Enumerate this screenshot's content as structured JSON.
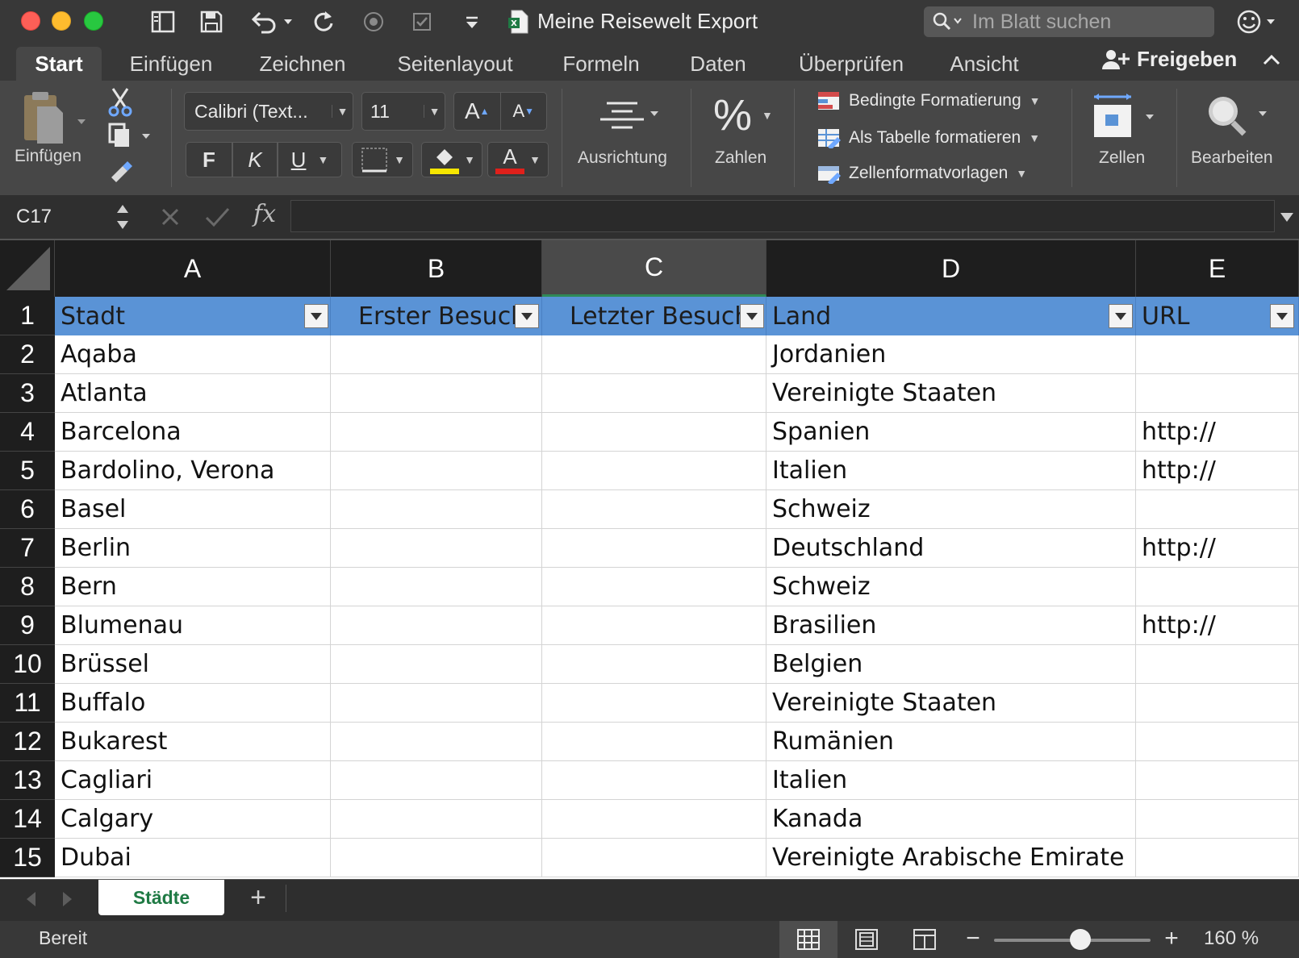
{
  "window": {
    "title": "Meine Reisewelt Export",
    "search_placeholder": "Im Blatt suchen"
  },
  "ribbon_tabs": [
    "Start",
    "Einfügen",
    "Zeichnen",
    "Seitenlayout",
    "Formeln",
    "Daten",
    "Überprüfen",
    "Ansicht"
  ],
  "share_label": "Freigeben",
  "ribbon": {
    "paste_label": "Einfügen",
    "font_name": "Calibri (Text...",
    "font_size": "11",
    "bold_label": "F",
    "italic_label": "K",
    "underline_label": "U",
    "grow_font": "A",
    "shrink_font": "A",
    "font_color_letter": "A",
    "alignment_label": "Ausrichtung",
    "number_label": "Zahlen",
    "percent_symbol": "%",
    "conditional_format": "Bedingte Formatierung",
    "format_as_table": "Als Tabelle formatieren",
    "cell_styles": "Zellenformatvorlagen",
    "cells_label": "Zellen",
    "editing_label": "Bearbeiten",
    "fill_color": "#f6e600",
    "font_color": "#e0201b"
  },
  "formula_bar": {
    "name_box": "C17",
    "fx": "fx",
    "formula": ""
  },
  "columns": [
    "A",
    "B",
    "C",
    "D",
    "E"
  ],
  "selected_column": "C",
  "header_row": {
    "row_number": "1",
    "cells": [
      "Stadt",
      "Erster Besuch",
      "Letzter Besuch",
      "Land",
      "URL"
    ],
    "header_color": "#5a93d6"
  },
  "rows": [
    {
      "n": "2",
      "stadt": "Aqaba",
      "land": "Jordanien",
      "url": ""
    },
    {
      "n": "3",
      "stadt": "Atlanta",
      "land": "Vereinigte Staaten",
      "url": ""
    },
    {
      "n": "4",
      "stadt": "Barcelona",
      "land": "Spanien",
      "url": "http://"
    },
    {
      "n": "5",
      "stadt": "Bardolino, Verona",
      "land": "Italien",
      "url": "http://"
    },
    {
      "n": "6",
      "stadt": "Basel",
      "land": "Schweiz",
      "url": ""
    },
    {
      "n": "7",
      "stadt": "Berlin",
      "land": "Deutschland",
      "url": "http://"
    },
    {
      "n": "8",
      "stadt": "Bern",
      "land": "Schweiz",
      "url": ""
    },
    {
      "n": "9",
      "stadt": "Blumenau",
      "land": "Brasilien",
      "url": "http://"
    },
    {
      "n": "10",
      "stadt": "Brüssel",
      "land": "Belgien",
      "url": ""
    },
    {
      "n": "11",
      "stadt": "Buffalo",
      "land": "Vereinigte Staaten",
      "url": ""
    },
    {
      "n": "12",
      "stadt": "Bukarest",
      "land": "Rumänien",
      "url": ""
    },
    {
      "n": "13",
      "stadt": "Cagliari",
      "land": "Italien",
      "url": ""
    },
    {
      "n": "14",
      "stadt": "Calgary",
      "land": "Kanada",
      "url": ""
    },
    {
      "n": "15",
      "stadt": "Dubai",
      "land": "Vereinigte Arabische Emirate",
      "url": ""
    }
  ],
  "sheet_tabs": [
    "Städte"
  ],
  "add_sheet": "+",
  "status": {
    "text": "Bereit",
    "zoom_minus": "−",
    "zoom_plus": "+",
    "zoom": "160 %",
    "zoom_fraction": 0.55
  }
}
